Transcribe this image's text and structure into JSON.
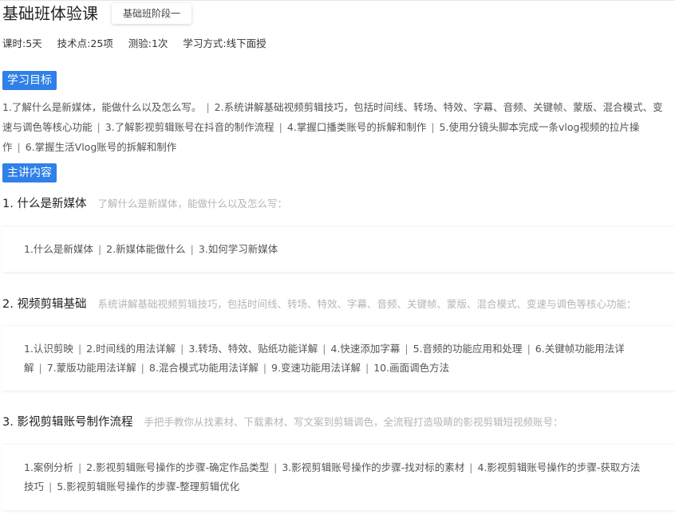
{
  "header": {
    "title": "基础班体验课",
    "stage_tag": "基础班阶段一"
  },
  "meta": {
    "duration": "课时:5天",
    "points": "技术点:25项",
    "quiz": "测验:1次",
    "mode": "学习方式:线下面授"
  },
  "goals": {
    "label": "学习目标",
    "items": [
      "1.了解什么是新媒体，能做什么以及怎么写。",
      "2.系统讲解基础视频剪辑技巧，包括时间线、转场、特效、字幕、音频、关键帧、蒙版、混合模式、变速与调色等核心功能",
      "3.了解影视剪辑账号在抖音的制作流程",
      "4.掌握口播类账号的拆解和制作",
      "5.使用分镜头脚本完成一条vlog视频的拉片操作",
      "6.掌握生活Vlog账号的拆解和制作"
    ]
  },
  "content": {
    "label": "主讲内容",
    "topics": [
      {
        "title": "1. 什么是新媒体",
        "desc": "了解什么是新媒体，能做什么以及怎么写：",
        "items": [
          "1.什么是新媒体",
          "2.新媒体能做什么",
          "3.如何学习新媒体"
        ]
      },
      {
        "title": "2. 视频剪辑基础",
        "desc": "系统讲解基础视频剪辑技巧，包括时间线、转场、特效、字幕、音频、关键帧、蒙版、混合模式、变速与调色等核心功能：",
        "items": [
          "1.认识剪映",
          "2.时间线的用法详解",
          "3.转场、特效、贴纸功能详解",
          "4.快速添加字幕",
          "5.音频的功能应用和处理",
          "6.关键帧功能用法详解",
          "7.蒙版功能用法详解",
          "8.混合模式功能用法详解",
          "9.变速功能用法详解",
          "10.画面调色方法"
        ]
      },
      {
        "title": "3. 影视剪辑账号制作流程",
        "desc": "手把手教你从找素材、下载素材、写文案到剪辑调色，全流程打造吸睛的影视剪辑短视频账号：",
        "items": [
          "1.案例分析",
          "2.影视剪辑账号操作的步骤-确定作品类型",
          "3.影视剪辑账号操作的步骤-找对标的素材",
          "4.影视剪辑账号操作的步骤-获取方法技巧",
          "5.影视剪辑账号操作的步骤-整理剪辑优化"
        ]
      }
    ]
  }
}
